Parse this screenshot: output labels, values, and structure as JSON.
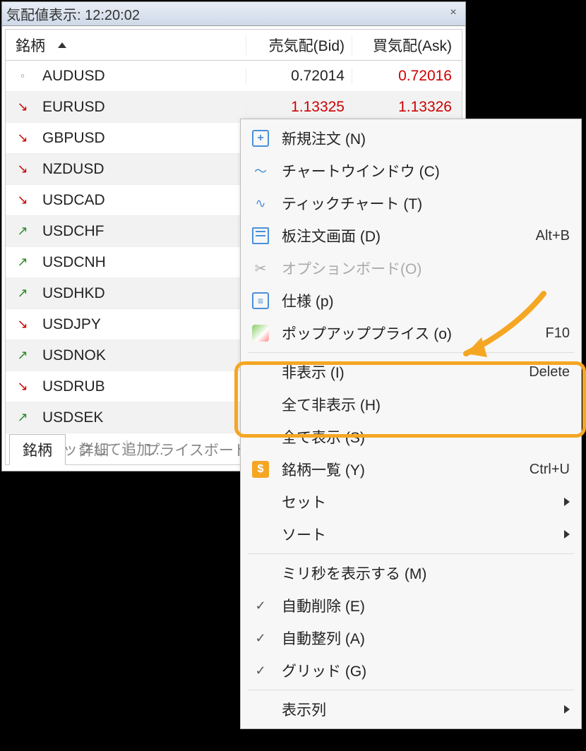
{
  "window": {
    "title": "気配値表示: 12:20:02"
  },
  "headers": {
    "symbol": "銘柄",
    "bid": "売気配(Bid)",
    "ask": "買気配(Ask)"
  },
  "rows": [
    {
      "trend": "dot",
      "symbol": "AUDUSD",
      "bid": "0.72014",
      "bidClass": "price-neutral",
      "ask": "0.72016",
      "askClass": "price-up",
      "alt": false
    },
    {
      "trend": "down",
      "symbol": "EURUSD",
      "bid": "1.13325",
      "bidClass": "price-up",
      "ask": "1.13326",
      "askClass": "price-up",
      "alt": true
    },
    {
      "trend": "down",
      "symbol": "GBPUSD",
      "bid": "",
      "bidClass": "",
      "ask": "",
      "askClass": "",
      "alt": false
    },
    {
      "trend": "down",
      "symbol": "NZDUSD",
      "bid": "",
      "bidClass": "",
      "ask": "",
      "askClass": "",
      "alt": true
    },
    {
      "trend": "down",
      "symbol": "USDCAD",
      "bid": "",
      "bidClass": "",
      "ask": "",
      "askClass": "",
      "alt": false
    },
    {
      "trend": "up",
      "symbol": "USDCHF",
      "bid": "",
      "bidClass": "",
      "ask": "",
      "askClass": "",
      "alt": true
    },
    {
      "trend": "up",
      "symbol": "USDCNH",
      "bid": "",
      "bidClass": "",
      "ask": "",
      "askClass": "",
      "alt": false
    },
    {
      "trend": "up",
      "symbol": "USDHKD",
      "bid": "",
      "bidClass": "",
      "ask": "",
      "askClass": "",
      "alt": true
    },
    {
      "trend": "down",
      "symbol": "USDJPY",
      "bid": "",
      "bidClass": "",
      "ask": "",
      "askClass": "",
      "alt": false
    },
    {
      "trend": "up",
      "symbol": "USDNOK",
      "bid": "",
      "bidClass": "",
      "ask": "",
      "askClass": "",
      "alt": true
    },
    {
      "trend": "down",
      "symbol": "USDRUB",
      "bid": "",
      "bidClass": "",
      "ask": "",
      "askClass": "",
      "alt": false
    },
    {
      "trend": "up",
      "symbol": "USDSEK",
      "bid": "",
      "bidClass": "",
      "ask": "",
      "askClass": "",
      "alt": true
    }
  ],
  "addRow": "クリックして追加...",
  "tabs": {
    "symbols": "銘柄",
    "details": "詳細",
    "priceboard": "プライスボード"
  },
  "menu": {
    "new_order": "新規注文 (N)",
    "chart_window": "チャートウインドウ (C)",
    "tick_chart": "ティックチャート (T)",
    "depth": "板注文画面 (D)",
    "depth_sc": "Alt+B",
    "option_board": "オプションボード(O)",
    "spec": "仕様 (p)",
    "popup": "ポップアッププライス (o)",
    "popup_sc": "F10",
    "hide": "非表示 (I)",
    "hide_sc": "Delete",
    "hide_all": "全て非表示 (H)",
    "show_all": "全て表示 (S)",
    "symbol_list": "銘柄一覧 (Y)",
    "symbol_list_sc": "Ctrl+U",
    "set": "セット",
    "sort": "ソート",
    "show_ms": "ミリ秒を表示する (M)",
    "auto_delete": "自動削除 (E)",
    "auto_arrange": "自動整列 (A)",
    "grid": "グリッド (G)",
    "columns": "表示列"
  }
}
